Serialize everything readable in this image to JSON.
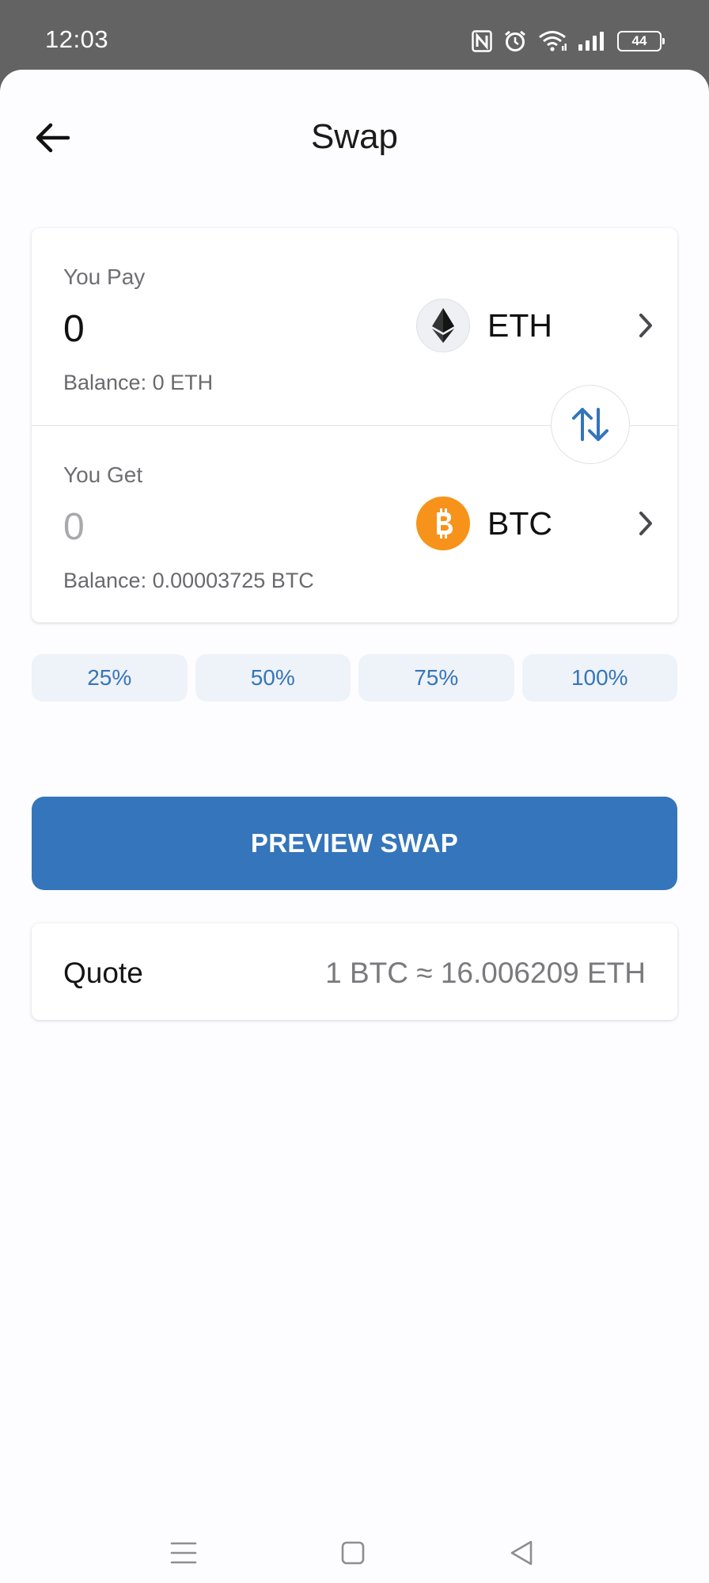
{
  "status_bar": {
    "time": "12:03",
    "battery": "44",
    "icons": [
      "nfc-icon",
      "alarm-icon",
      "wifi-icon",
      "signal-icon",
      "battery-icon"
    ]
  },
  "header": {
    "title": "Swap",
    "back_icon": "arrow-left-icon"
  },
  "pay": {
    "label": "You Pay",
    "amount": "0",
    "balance": "Balance: 0 ETH",
    "token": "ETH"
  },
  "get": {
    "label": "You Get",
    "amount": "0",
    "balance": "Balance: 0.00003725 BTC",
    "token": "BTC"
  },
  "percent_options": [
    "25%",
    "50%",
    "75%",
    "100%"
  ],
  "preview_button": "PREVIEW SWAP",
  "quote": {
    "label": "Quote",
    "value": "1 BTC ≈ 16.006209 ETH"
  },
  "colors": {
    "accent": "#3475bb",
    "chip_bg": "#eef2f9",
    "chip_text": "#3676b8",
    "btc": "#f7931a"
  }
}
